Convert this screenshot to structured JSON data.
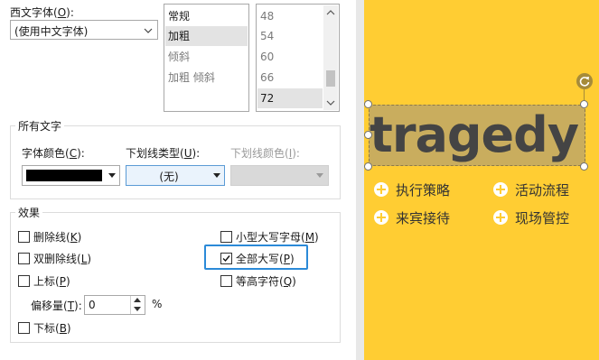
{
  "western_font": {
    "label": "西文字体(",
    "hotkey": "O",
    "label_end": "):",
    "value": "(使用中文字体)"
  },
  "font_style_list": {
    "items": [
      "常规",
      "加粗",
      "倾斜",
      "加粗 倾斜"
    ],
    "selected": "加粗"
  },
  "font_size_list": {
    "items": [
      "48",
      "54",
      "60",
      "66",
      "72"
    ],
    "selected": "72"
  },
  "all_text": {
    "title": "所有文字",
    "font_color": {
      "label": "字体颜色(",
      "hotkey": "C",
      "label_end": "):",
      "swatch": "#000000"
    },
    "underline_type": {
      "label": "下划线类型(",
      "hotkey": "U",
      "label_end": "):",
      "value": "(无)"
    },
    "underline_color": {
      "label": "下划线颜色(",
      "hotkey": "I",
      "label_end": "):"
    }
  },
  "effects": {
    "title": "效果",
    "strikethrough": {
      "label": "删除线(",
      "hotkey": "K",
      "label_end": ")",
      "checked": false
    },
    "double_strikethrough": {
      "label": "双删除线(",
      "hotkey": "L",
      "label_end": ")",
      "checked": false
    },
    "superscript": {
      "label": "上标(",
      "hotkey": "P",
      "label_end": ")",
      "checked": false
    },
    "offset": {
      "label": "偏移量(",
      "hotkey": "T",
      "label_end": "):",
      "value": "0",
      "unit": "%"
    },
    "subscript": {
      "label": "下标(",
      "hotkey": "B",
      "label_end": ")",
      "checked": false
    },
    "small_caps": {
      "label": "小型大写字母(",
      "hotkey": "M",
      "label_end": ")",
      "checked": false
    },
    "all_caps": {
      "label": "全部大写(",
      "hotkey": "P",
      "label_end": ")",
      "checked": true
    },
    "equalize_height": {
      "label": "等高字符(",
      "hotkey": "Q",
      "label_end": ")",
      "checked": false
    }
  },
  "slide": {
    "background": "#ffcd33",
    "title_text": "tragedy",
    "bullets": [
      "执行策略",
      "活动流程",
      "来宾接待",
      "现场管控"
    ]
  },
  "colors": {
    "highlight_border": "#2b8ad8",
    "title_band": "#c9ad5e"
  }
}
